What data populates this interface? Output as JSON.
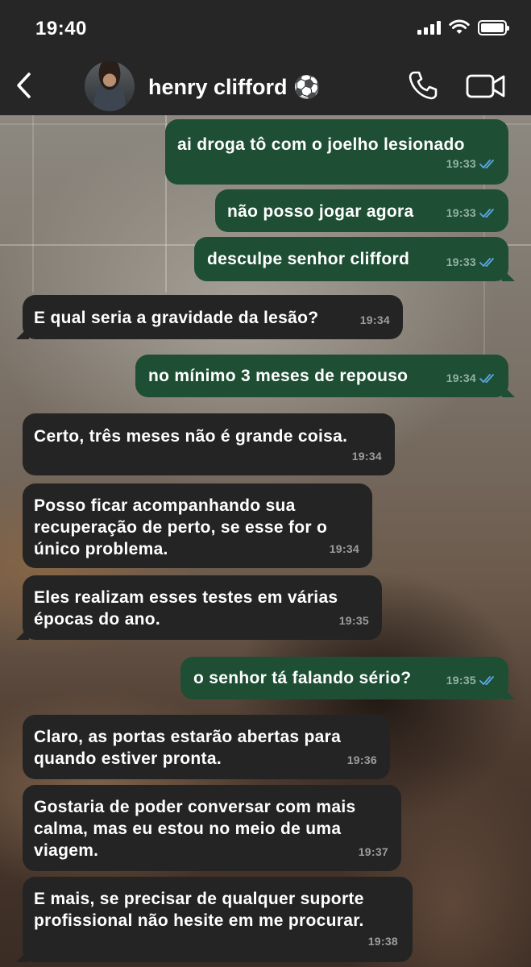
{
  "status_bar": {
    "time": "19:40"
  },
  "header": {
    "contact_name": "henry clifford ⚽",
    "icons": [
      "back-chevron-icon",
      "avatar",
      "phone-icon",
      "video-camera-icon"
    ]
  },
  "colors": {
    "outgoing_bubble": "#1e4f34",
    "incoming_bubble": "#242424",
    "read_ticks": "#5aa8e6",
    "header_bg": "#262626"
  },
  "messages": [
    {
      "dir": "out",
      "text": "ai droga tô com o joelho lesionado",
      "time": "19:33",
      "read": true
    },
    {
      "dir": "out",
      "text": "não posso jogar agora",
      "time": "19:33",
      "read": true
    },
    {
      "dir": "out",
      "text": "desculpe senhor clifford",
      "time": "19:33",
      "read": true
    },
    {
      "dir": "in",
      "text": "E qual seria a gravidade da lesão?",
      "time": "19:34"
    },
    {
      "dir": "out",
      "text": "no mínimo 3 meses de repouso",
      "time": "19:34",
      "read": true
    },
    {
      "dir": "in",
      "text": "Certo, três meses não é grande coisa.",
      "time": "19:34"
    },
    {
      "dir": "in",
      "text": "Posso ficar acompanhando sua\nrecuperação de perto, se esse for o\núnico problema.",
      "time": "19:34"
    },
    {
      "dir": "in",
      "text": "Eles realizam esses testes em várias\népocas do ano.",
      "time": "19:35"
    },
    {
      "dir": "out",
      "text": "o senhor tá falando sério?",
      "time": "19:35",
      "read": true
    },
    {
      "dir": "in",
      "text": "Claro, as portas estarão abertas para\nquando estiver pronta.",
      "time": "19:36"
    },
    {
      "dir": "in",
      "text": "Gostaria de poder conversar com mais\ncalma, mas eu estou no meio de uma\nviagem.",
      "time": "19:37"
    },
    {
      "dir": "in",
      "text": "E mais, se precisar de qualquer suporte\nprofissional não hesite em me procurar.",
      "time": "19:38"
    }
  ]
}
